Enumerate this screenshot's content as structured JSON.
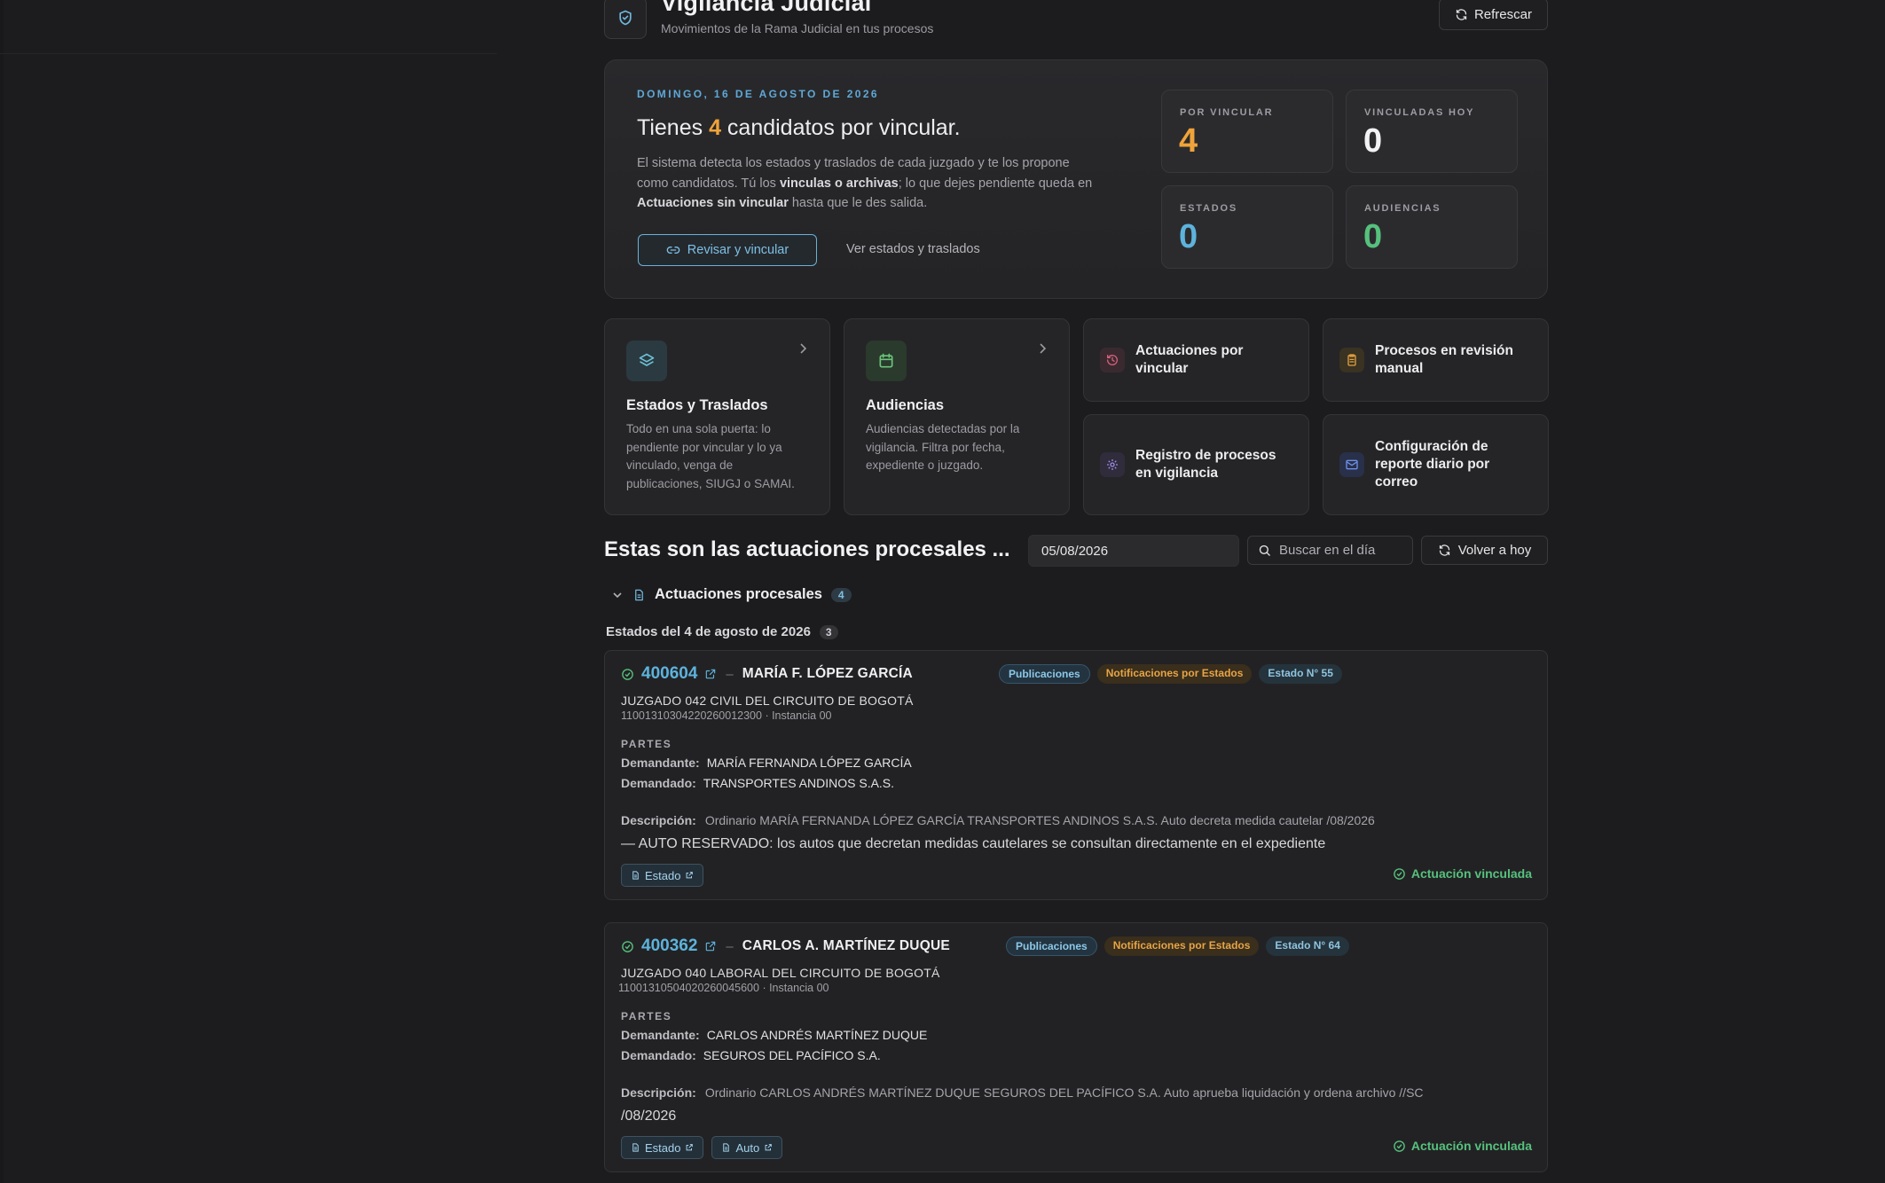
{
  "header": {
    "title": "Vigilancia Judicial",
    "subtitle": "Movimientos de la Rama Judicial en tus procesos",
    "refresh_label": "Refrescar"
  },
  "hero": {
    "date": "DOMINGO, 16 DE AGOSTO DE 2026",
    "title_pre": "Tienes ",
    "title_count": "4",
    "title_post": " candidatos por vincular.",
    "desc_1": "El sistema detecta los estados y traslados de cada juzgado y te los propone como candidatos. Tú los ",
    "desc_b1": "vinculas o archivas",
    "desc_2": "; lo que dejes pendiente queda en ",
    "desc_b2": "Actuaciones sin vincular",
    "desc_3": " hasta que le des salida.",
    "primary_button": "Revisar y vincular",
    "secondary_link": "Ver estados y traslados",
    "stats": [
      {
        "label": "POR VINCULAR",
        "value": "4",
        "color": "#f0a33a"
      },
      {
        "label": "VINCULADAS HOY",
        "value": "0",
        "color": "#f2f2f4"
      },
      {
        "label": "ESTADOS",
        "value": "0",
        "color": "#5db3dc"
      },
      {
        "label": "AUDIENCIAS",
        "value": "0",
        "color": "#56c17d"
      }
    ]
  },
  "cards": {
    "estados": {
      "title": "Estados y Traslados",
      "desc": "Todo en una sola puerta: lo pendiente por vincular y lo ya vinculado, venga de publicaciones, SIUGJ o SAMAI."
    },
    "audiencias": {
      "title": "Audiencias",
      "desc": "Audiencias detectadas por la vigilancia. Filtra por fecha, expediente o juzgado."
    },
    "quick": [
      {
        "label": "Actuaciones por vincular",
        "icon": "history-icon",
        "color": "#d4607a"
      },
      {
        "label": "Procesos en revisión manual",
        "icon": "clipboard-icon",
        "color": "#e0a040"
      },
      {
        "label": "Registro de procesos en vigilancia",
        "icon": "gear-icon",
        "color": "#9b8ce0"
      },
      {
        "label": "Configuración de reporte diario por correo",
        "icon": "mail-icon",
        "color": "#6f8fe8"
      }
    ]
  },
  "toolbar": {
    "section_title": "Estas son las actuaciones procesales ...",
    "date_value": "05/08/2026",
    "search_placeholder": "Buscar en el día",
    "today_button": "Volver a hoy"
  },
  "group": {
    "title": "Actuaciones procesales",
    "count": "4",
    "sub_title": "Estados del 4 de agosto de 2026",
    "sub_count": "3"
  },
  "records": [
    {
      "number": "400604",
      "name": "MARÍA F. LÓPEZ GARCÍA",
      "tags": [
        "Publicaciones",
        "Notificaciones por Estados",
        "Estado N° 55"
      ],
      "court": "JUZGADO 042 CIVIL DEL CIRCUITO DE BOGOTÁ",
      "expediente": "11001310304220260012300 · Instancia 00",
      "partes_label": "PARTES",
      "demandante_label": "Demandante:",
      "demandante": "MARÍA FERNANDA LÓPEZ GARCÍA",
      "demandado_label": "Demandado:",
      "demandado": "TRANSPORTES ANDINOS S.A.S.",
      "desc_label": "Descripción:",
      "desc": "Ordinario MARÍA FERNANDA LÓPEZ GARCÍA TRANSPORTES ANDINOS S.A.S. Auto decreta medida cautelar /08/2026",
      "note": "— AUTO RESERVADO: los autos que decretan medidas cautelares se consultan directamente en el expediente",
      "docs": [
        "Estado"
      ],
      "status": "Actuación vinculada"
    },
    {
      "number": "400362",
      "name": "CARLOS A. MARTÍNEZ DUQUE",
      "tags": [
        "Publicaciones",
        "Notificaciones por Estados",
        "Estado N° 64"
      ],
      "court": "JUZGADO 040 LABORAL DEL CIRCUITO DE BOGOTÁ",
      "expediente": "11001310504020260045600 · Instancia 00",
      "partes_label": "PARTES",
      "demandante_label": "Demandante:",
      "demandante": "CARLOS ANDRÉS MARTÍNEZ DUQUE",
      "demandado_label": "Demandado:",
      "demandado": "SEGUROS DEL PACÍFICO S.A.",
      "desc_label": "Descripción:",
      "desc": "Ordinario CARLOS ANDRÉS MARTÍNEZ DUQUE SEGUROS DEL PACÍFICO S.A. Auto aprueba liquidación y ordena archivo //SC",
      "note": "/08/2026",
      "docs": [
        "Estado",
        "Auto"
      ],
      "status": "Actuación vinculada"
    }
  ]
}
